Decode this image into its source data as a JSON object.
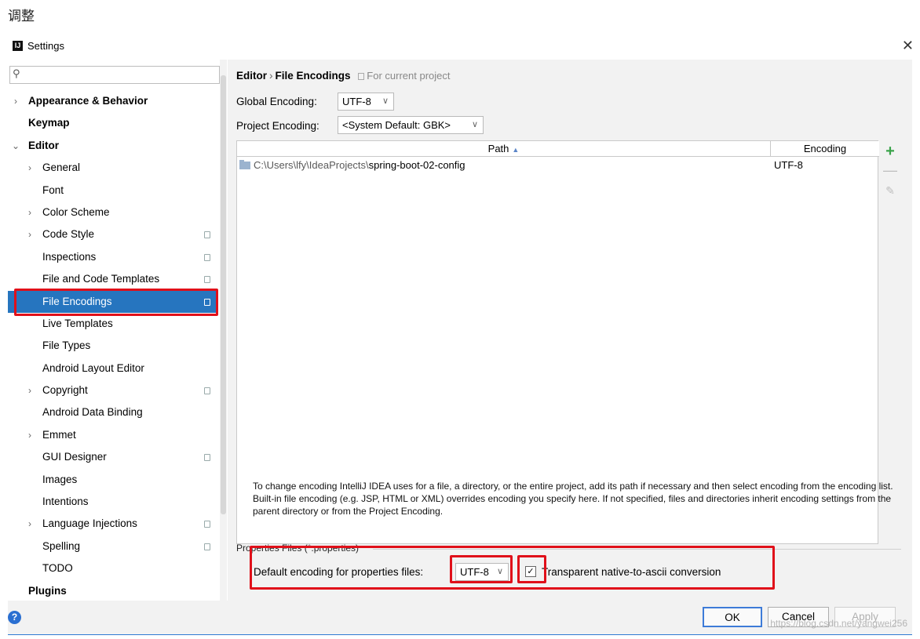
{
  "caption": "调整",
  "window": {
    "title": "Settings",
    "close_glyph": "✕"
  },
  "sidebar": {
    "search_placeholder": "",
    "items": [
      {
        "label": "Appearance & Behavior",
        "arrow": "›",
        "bold": true
      },
      {
        "label": "Keymap",
        "bold": true
      },
      {
        "label": "Editor",
        "arrow": "⌄",
        "bold": true
      },
      {
        "label": "General",
        "arrow": "›"
      },
      {
        "label": "Font"
      },
      {
        "label": "Color Scheme",
        "arrow": "›"
      },
      {
        "label": "Code Style",
        "arrow": "›",
        "project": true
      },
      {
        "label": "Inspections",
        "project": true
      },
      {
        "label": "File and Code Templates",
        "project": true
      },
      {
        "label": "File Encodings",
        "project": true,
        "selected": true
      },
      {
        "label": "Live Templates"
      },
      {
        "label": "File Types"
      },
      {
        "label": "Android Layout Editor"
      },
      {
        "label": "Copyright",
        "arrow": "›",
        "project": true
      },
      {
        "label": "Android Data Binding"
      },
      {
        "label": "Emmet",
        "arrow": "›"
      },
      {
        "label": "GUI Designer",
        "project": true
      },
      {
        "label": "Images"
      },
      {
        "label": "Intentions"
      },
      {
        "label": "Language Injections",
        "arrow": "›",
        "project": true
      },
      {
        "label": "Spelling",
        "project": true
      },
      {
        "label": "TODO"
      },
      {
        "label": "Plugins",
        "bold": true
      }
    ]
  },
  "content": {
    "breadcrumb": {
      "parent": "Editor",
      "separator": "›",
      "current": "File Encodings",
      "note": "For current project"
    },
    "global_encoding": {
      "label": "Global Encoding:",
      "value": "UTF-8"
    },
    "project_encoding": {
      "label": "Project Encoding:",
      "value": "<System Default: GBK>"
    },
    "table": {
      "columns": [
        "Path",
        "Encoding"
      ],
      "sort_indicator": "▲",
      "rows": [
        {
          "path_prefix": "C:\\Users\\lfy\\IdeaProjects\\",
          "path_name": "spring-boot-02-config",
          "encoding": "UTF-8"
        }
      ],
      "tools": {
        "add": "+",
        "remove": "—",
        "edit": "✎"
      }
    },
    "help_text": "To change encoding IntelliJ IDEA uses for a file, a directory, or the entire project, add its path if necessary and then select encoding from the encoding list. Built-in file encoding (e.g. JSP, HTML or XML) overrides encoding you specify here. If not specified, files and directories inherit encoding settings from the parent directory or from the Project Encoding.",
    "properties": {
      "section_title": "Properties Files (*.properties)",
      "default_label": "Default encoding for properties files:",
      "default_value": "UTF-8",
      "checkbox_checked": true,
      "checkbox_glyph": "✓",
      "checkbox_label": "Transparent native-to-ascii conversion"
    }
  },
  "footer": {
    "help_glyph": "?",
    "ok": "OK",
    "cancel": "Cancel",
    "apply": "Apply",
    "watermark": "https://blog.csdn.net/yangwei256"
  },
  "colors": {
    "selection": "#2675bf",
    "highlight": "#e0101a",
    "add_icon": "#3aa34a",
    "accent": "#2f7ad2"
  }
}
